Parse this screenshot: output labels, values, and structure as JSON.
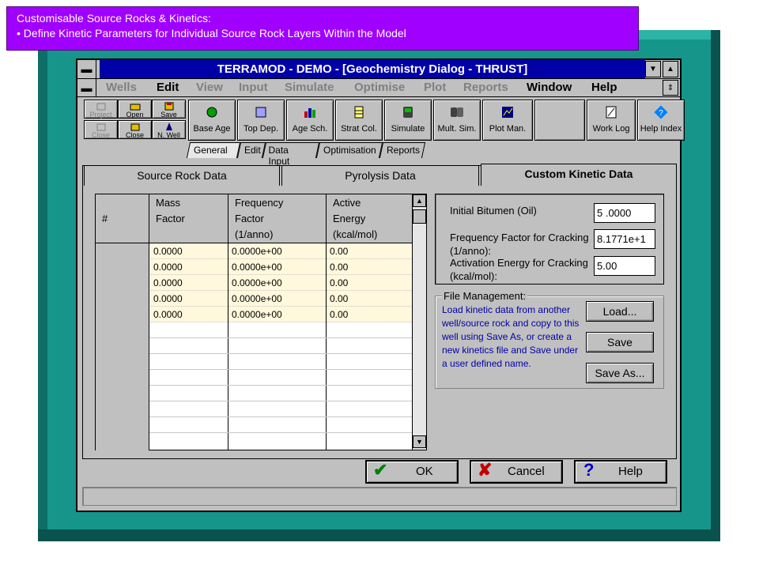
{
  "caption": {
    "line1": "Customisable Source Rocks & Kinetics:",
    "line2": "• Define Kinetic Parameters for Individual Source Rock Layers Within the Model"
  },
  "window": {
    "title": "TERRAMOD - DEMO - [Geochemistry Dialog - THRUST]"
  },
  "menu": [
    "Wells",
    "Edit",
    "View",
    "Input",
    "Simulate",
    "Optimise",
    "Plot",
    "Reports",
    "Window",
    "Help"
  ],
  "small_tools": [
    "Project",
    "Open",
    "Save",
    "Close",
    "Close",
    "N. Well"
  ],
  "big_tools": [
    "Base Age",
    "Top Dep.",
    "Age Sch.",
    "Strat Col.",
    "Simulate",
    "Mult. Sim.",
    "Plot Man.",
    "Work Log",
    "Help Index"
  ],
  "sub_tabs": [
    "General",
    "Edit",
    "Data Input",
    "Optimisation",
    "Reports"
  ],
  "data_tabs": [
    "Source Rock Data",
    "Pyrolysis Data",
    "Custom Kinetic Data"
  ],
  "grid": {
    "headers": {
      "index": "#",
      "mass": [
        "Mass",
        "Factor"
      ],
      "freq": [
        "Frequency",
        "Factor",
        "(1/anno)"
      ],
      "energy": [
        "Active",
        "Energy",
        "(kcal/mol)"
      ]
    },
    "rows": [
      [
        "0.0000",
        "0.0000e+00",
        "0.00"
      ],
      [
        "0.0000",
        "0.0000e+00",
        "0.00"
      ],
      [
        "0.0000",
        "0.0000e+00",
        "0.00"
      ],
      [
        "0.0000",
        "0.0000e+00",
        "0.00"
      ],
      [
        "0.0000",
        "0.0000e+00",
        "0.00"
      ]
    ]
  },
  "kinetics": {
    "bitumen_label": "Initial Bitumen (Oil)",
    "bitumen_value": "5 .0000",
    "freq_label": "Frequency Factor for Cracking (1/anno):",
    "freq_value": "8.1771e+1",
    "energy_label": "Activation Energy for Cracking (kcal/mol):",
    "energy_value": "5.00"
  },
  "file_mgmt": {
    "title": "File Management:",
    "text": "Load kinetic data from another well/source rock and copy to this well using Save As, or create a new kinetics file and Save under a user defined name.",
    "load": "Load...",
    "save": "Save",
    "save_as": "Save As..."
  },
  "buttons": {
    "ok": "OK",
    "cancel": "Cancel",
    "help": "Help"
  },
  "colors": {
    "teal": "#16958a",
    "caption_bg": "#a000ff",
    "title_bg": "#0000a8"
  }
}
